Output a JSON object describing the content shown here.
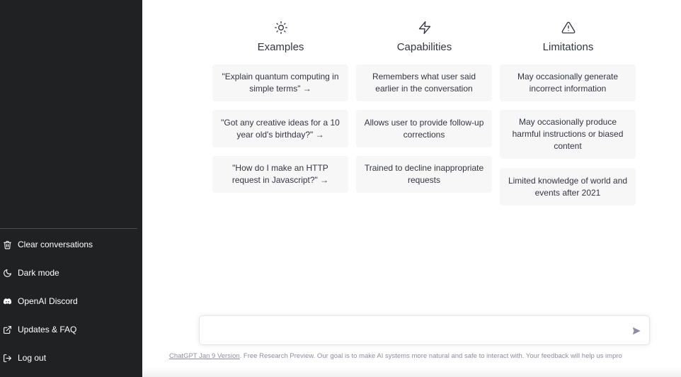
{
  "sidebar": {
    "items": [
      {
        "label": "Clear conversations",
        "icon": "trash-icon"
      },
      {
        "label": "Dark mode",
        "icon": "moon-icon"
      },
      {
        "label": "OpenAI Discord",
        "icon": "discord-icon"
      },
      {
        "label": "Updates & FAQ",
        "icon": "external-link-icon"
      },
      {
        "label": "Log out",
        "icon": "logout-icon"
      }
    ]
  },
  "columns": [
    {
      "title": "Examples",
      "icon": "sun-icon",
      "cards": [
        "\"Explain quantum computing in simple terms\" →",
        "\"Got any creative ideas for a 10 year old's birthday?\" →",
        "\"How do I make an HTTP request in Javascript?\" →"
      ]
    },
    {
      "title": "Capabilities",
      "icon": "lightning-icon",
      "cards": [
        "Remembers what user said earlier in the conversation",
        "Allows user to provide follow-up corrections",
        "Trained to decline inappropriate requests"
      ]
    },
    {
      "title": "Limitations",
      "icon": "warning-icon",
      "cards": [
        "May occasionally generate incorrect information",
        "May occasionally produce harmful instructions or biased content",
        "Limited knowledge of world and events after 2021"
      ]
    }
  ],
  "input": {
    "value": "",
    "placeholder": ""
  },
  "footer": {
    "link_text": "ChatGPT Jan 9 Version",
    "text": ". Free Research Preview. Our goal is to make AI systems more natural and safe to interact with. Your feedback will help us impro"
  },
  "colors": {
    "sidebar_bg": "#202123",
    "card_bg": "#f7f7f8",
    "text": "#343541"
  }
}
